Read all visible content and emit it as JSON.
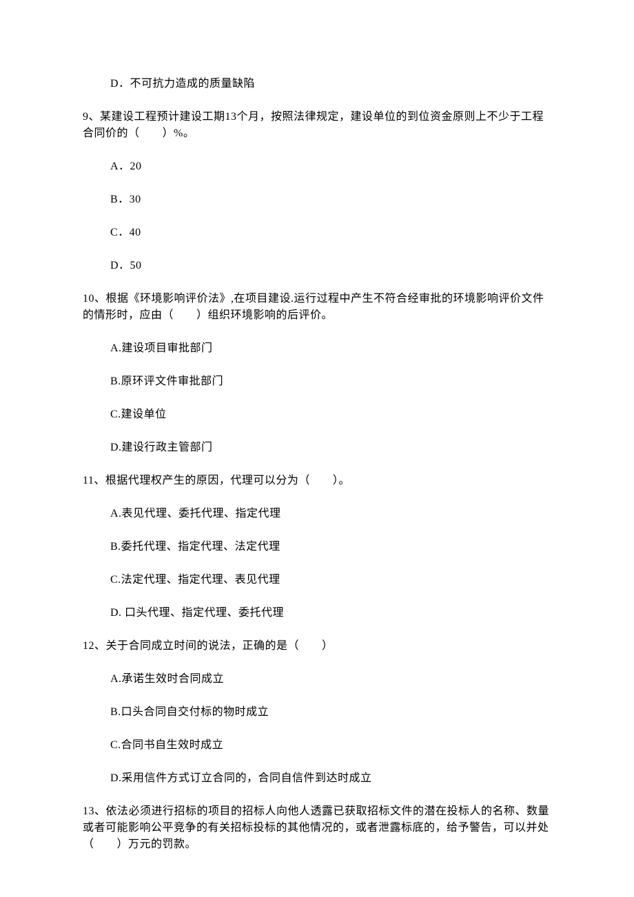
{
  "q8_optD": "D．不可抗力造成的质量缺陷",
  "q9": {
    "text": "9、某建设工程预计建设工期13个月，按照法律规定，建设单位的到位资金原则上不少于工程合同价的（　　）%。",
    "optA": "A．20",
    "optB": "B．30",
    "optC": "C．40",
    "optD": "D．50"
  },
  "q10": {
    "text": "10、根据《环境影响评价法》,在项目建设.运行过程中产生不符合经审批的环境影响评价文件的情形时，应由（　　）组织环境影响的后评价。",
    "optA": "A.建设项目审批部门",
    "optB": "B.原环评文件审批部门",
    "optC": "C.建设单位",
    "optD": "D.建设行政主管部门"
  },
  "q11": {
    "text": "11、根据代理权产生的原因，代理可以分为（　　）。",
    "optA": "A.表见代理、委托代理、指定代理",
    "optB": "B.委托代理、指定代理、法定代理",
    "optC": "C.法定代理、指定代理、表见代理",
    "optD": "D. 口头代理、指定代理、委托代理"
  },
  "q12": {
    "text": "12、关于合同成立时间的说法，正确的是（　　）",
    "optA": "A.承诺生效时合同成立",
    "optB": "B.口头合同自交付标的物时成立",
    "optC": "C.合同书自生效时成立",
    "optD": "D.采用信件方式订立合同的，合同自信件到达时成立"
  },
  "q13": {
    "text": "13、依法必须进行招标的项目的招标人向他人透露已获取招标文件的潜在投标人的名称、数量或者可能影响公平竞争的有关招标投标的其他情况的，或者泄露标底的，给予警告，可以并处（　　）万元的罚款。"
  }
}
